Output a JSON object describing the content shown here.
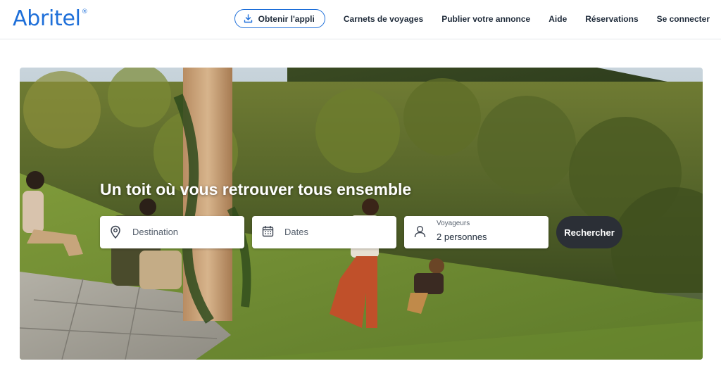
{
  "brand": {
    "name": "Abritel",
    "mark": "®"
  },
  "nav": {
    "app_label": "Obtenir l'appli",
    "items": [
      "Carnets de voyages",
      "Publier votre annonce",
      "Aide",
      "Réservations",
      "Se connecter"
    ]
  },
  "hero": {
    "tagline": "Un toit où vous retrouver tous ensemble"
  },
  "search": {
    "destination_placeholder": "Destination",
    "dates_placeholder": "Dates",
    "travelers_label": "Voyageurs",
    "travelers_value": "2 personnes",
    "submit_label": "Rechercher"
  },
  "colors": {
    "brand": "#1e6fd9",
    "search_button": "#2b2f36"
  },
  "icons": [
    "download-icon",
    "map-pin-icon",
    "calendar-icon",
    "person-icon"
  ]
}
